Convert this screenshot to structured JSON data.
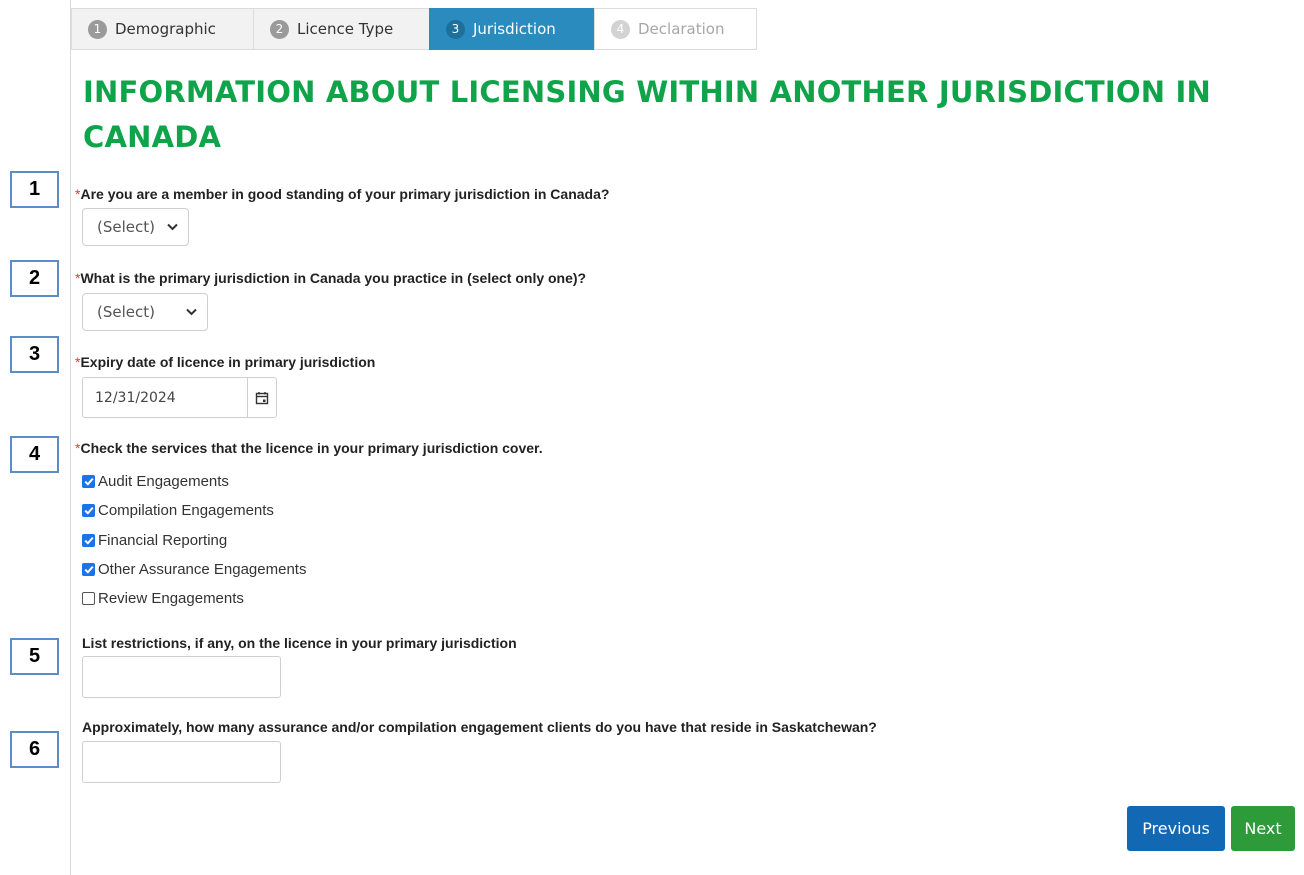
{
  "tabs": [
    {
      "num": "1",
      "label": "Demographic",
      "state": "done"
    },
    {
      "num": "2",
      "label": "Licence Type",
      "state": "done"
    },
    {
      "num": "3",
      "label": "Jurisdiction",
      "state": "active"
    },
    {
      "num": "4",
      "label": "Declaration",
      "state": "disabled"
    }
  ],
  "heading": "INFORMATION ABOUT LICENSING WITHIN ANOTHER JURISDICTION IN CANADA",
  "required_marker": "*",
  "questions": {
    "q1": {
      "num": "1",
      "label": "Are you are a member in good standing of your primary jurisdiction in Canada?",
      "value": "(Select)"
    },
    "q2": {
      "num": "2",
      "label": "What is the primary jurisdiction in Canada you practice in (select only one)?",
      "value": "(Select)"
    },
    "q3": {
      "num": "3",
      "label": "Expiry date of licence in primary jurisdiction",
      "value": "12/31/2024"
    },
    "q4": {
      "num": "4",
      "label": "Check the services that the licence in your primary jurisdiction cover.",
      "options": [
        {
          "label": "Audit Engagements",
          "checked": true
        },
        {
          "label": "Compilation Engagements",
          "checked": true
        },
        {
          "label": "Financial Reporting",
          "checked": true
        },
        {
          "label": "Other Assurance Engagements",
          "checked": true
        },
        {
          "label": "Review Engagements",
          "checked": false
        }
      ]
    },
    "q5": {
      "num": "5",
      "label": "List restrictions, if any, on the licence in your primary jurisdiction",
      "value": ""
    },
    "q6": {
      "num": "6",
      "label": "Approximately, how many assurance and/or compilation engagement clients do you have that reside in Saskatchewan?",
      "value": ""
    }
  },
  "buttons": {
    "previous": "Previous",
    "next": "Next"
  },
  "colors": {
    "heading": "#0fa34a",
    "active_tab": "#2a8bbf",
    "previous_button": "#1268b3",
    "next_button": "#2e9b3a"
  }
}
